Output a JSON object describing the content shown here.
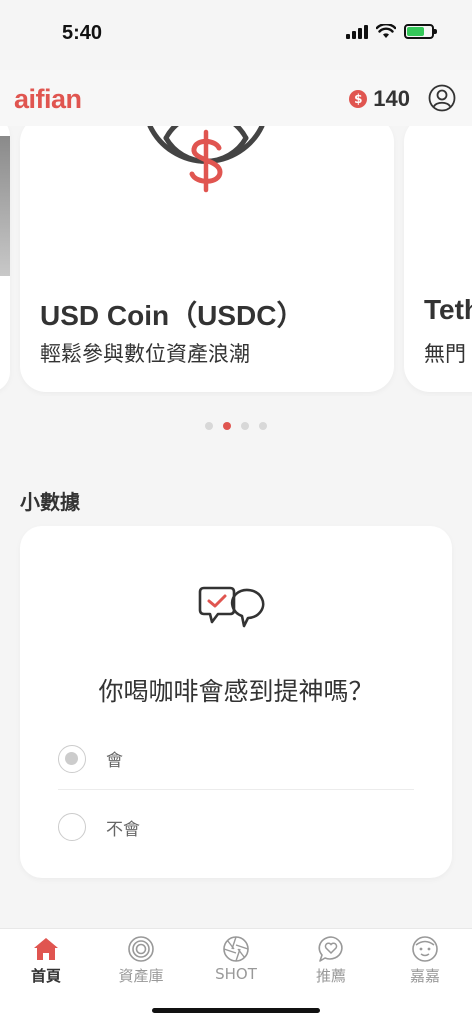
{
  "status": {
    "time": "5:40"
  },
  "header": {
    "logo": "aifian",
    "coin_symbol": "$",
    "coins": "140"
  },
  "carousel": {
    "cards": [
      {
        "title": "USD Coin（USDC）",
        "subtitle": "輕鬆參與數位資產浪潮",
        "icon": "usdc-coin-icon"
      },
      {
        "title": "Teth",
        "subtitle": "無門"
      }
    ]
  },
  "section": {
    "title": "小數據"
  },
  "poll": {
    "question": "你喝咖啡會感到提神嗎？",
    "options": [
      {
        "label": "會",
        "selected": true
      },
      {
        "label": "不會",
        "selected": false
      }
    ]
  },
  "tabs": [
    {
      "label": "首頁",
      "icon": "home-icon",
      "active": true
    },
    {
      "label": "資產庫",
      "icon": "asset-library-icon",
      "active": false
    },
    {
      "label": "SHOT",
      "icon": "shutter-icon",
      "active": false
    },
    {
      "label": "推薦",
      "icon": "heart-chat-icon",
      "active": false
    },
    {
      "label": "嘉嘉",
      "icon": "face-icon",
      "active": false
    }
  ],
  "colors": {
    "accent": "#e05550",
    "text": "#333333",
    "background": "#f5f5f5"
  }
}
